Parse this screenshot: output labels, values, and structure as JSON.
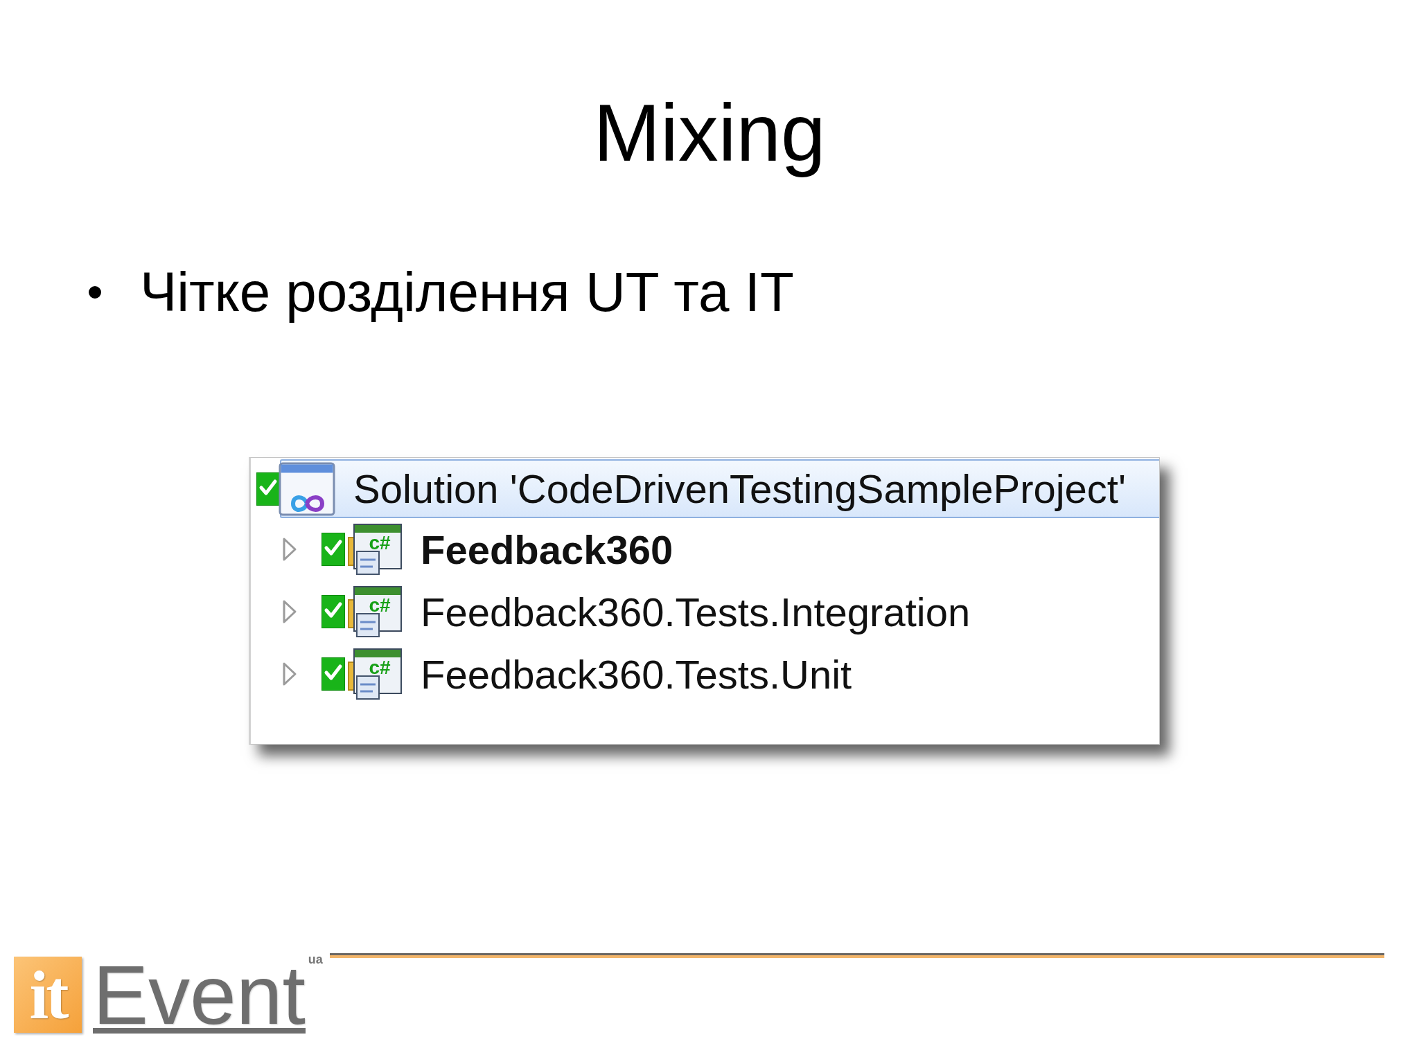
{
  "slide": {
    "title": "Mixing",
    "bullets": [
      "Чітке розділення UT та IT"
    ]
  },
  "solution_explorer": {
    "root": {
      "label": "Solution 'CodeDrivenTestingSampleProject'",
      "selected": true,
      "checked_in": true,
      "children": [
        {
          "label": "Feedback360",
          "icon_label": "c#",
          "startup": true,
          "expanded": false,
          "selected": false,
          "checked_in": true
        },
        {
          "label": "Feedback360.Tests.Integration",
          "icon_label": "c#",
          "startup": false,
          "expanded": false,
          "selected": false,
          "checked_in": true
        },
        {
          "label": "Feedback360.Tests.Unit",
          "icon_label": "c#",
          "startup": false,
          "expanded": false,
          "selected": false,
          "checked_in": true
        }
      ]
    }
  },
  "footer": {
    "logo": {
      "badge": "it",
      "wordmark": "Event",
      "suffix": "ua"
    }
  }
}
